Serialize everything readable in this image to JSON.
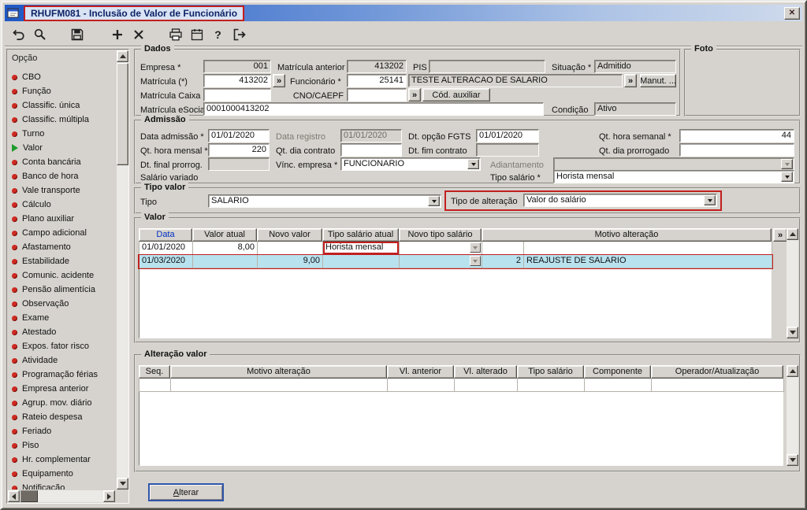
{
  "window": {
    "title": "RHUFM081 - Inclusão de Valor de Funcionário",
    "close_glyph": "✕"
  },
  "toolbar": {
    "icons": [
      "undo",
      "search",
      "save",
      "add",
      "delete",
      "print",
      "calendar",
      "help",
      "exit"
    ],
    "help_glyph": "?"
  },
  "sidebar": {
    "header": "Opção",
    "selected_item": "Valor",
    "items": [
      "CBO",
      "Função",
      "Classific. única",
      "Classific. múltipla",
      "Turno",
      "Valor",
      "Conta bancária",
      "Banco de hora",
      "Vale transporte",
      "Cálculo",
      "Plano auxiliar",
      "Campo adicional",
      "Afastamento",
      "Estabilidade",
      "Comunic. acidente",
      "Pensão alimentícia",
      "Observação",
      "Exame",
      "Atestado",
      "Expos. fator risco",
      "Atividade",
      "Programação férias",
      "Empresa anterior",
      "Agrup. mov. diário",
      "Rateio despesa",
      "Feriado",
      "Piso",
      "Hr. complementar",
      "Equipamento",
      "Notificação"
    ]
  },
  "dados": {
    "legend": "Dados",
    "empresa": {
      "label": "Empresa *",
      "value": "001"
    },
    "matricula_anterior": {
      "label": "Matrícula anterior",
      "value": "413202"
    },
    "pis": {
      "label": "PIS",
      "value": ""
    },
    "situacao": {
      "label": "Situação *",
      "value": "Admitido"
    },
    "matricula": {
      "label": "Matrícula (*)",
      "value": "413202"
    },
    "funcionario": {
      "label": "Funcionário *",
      "code": "25141",
      "name": "TESTE ALTERACAO DE SALARIO"
    },
    "manut_button": "Manut. ...",
    "matricula_caixa": {
      "label": "Matrícula Caixa",
      "value": ""
    },
    "cno_caepf": {
      "label": "CNO/CAEPF",
      "value": ""
    },
    "cod_auxiliar_button": "Cód. auxiliar",
    "matricula_esocial": {
      "label": "Matrícula eSocial",
      "value": "0001000413202"
    },
    "condicao": {
      "label": "Condição",
      "value": "Ativo"
    },
    "lookup_glyph": "»"
  },
  "foto": {
    "legend": "Foto"
  },
  "admissao": {
    "legend": "Admissão",
    "data_admissao": {
      "label": "Data admissão *",
      "value": "01/01/2020"
    },
    "data_registro": {
      "label": "Data registro",
      "value": "01/01/2020"
    },
    "dt_opcao_fgts": {
      "label": "Dt. opção FGTS",
      "value": "01/01/2020"
    },
    "qt_hora_semanal": {
      "label": "Qt. hora semanal *",
      "value": "44"
    },
    "qt_hora_mensal": {
      "label": "Qt. hora mensal *",
      "value": "220"
    },
    "qt_dia_contrato": {
      "label": "Qt. dia contrato",
      "value": ""
    },
    "dt_fim_contrato": {
      "label": "Dt. fim contrato",
      "value": ""
    },
    "qt_dia_prorrogado": {
      "label": "Qt. dia prorrogado",
      "value": ""
    },
    "dt_final_prorrog": {
      "label": "Dt. final prorrog.",
      "value": ""
    },
    "vinc_empresa": {
      "label": "Vínc. empresa *",
      "value": "FUNCIONARIO"
    },
    "adiantamento": {
      "label": "Adiantamento",
      "value": ""
    },
    "salario_variado": {
      "label": "Salário variado"
    },
    "tipo_salario": {
      "label": "Tipo salário *",
      "value": "Horista mensal"
    }
  },
  "tipo_valor": {
    "legend": "Tipo valor",
    "tipo": {
      "label": "Tipo",
      "value": "SALARIO"
    },
    "tipo_alteracao": {
      "label": "Tipo de alteração",
      "value": "Valor do salário"
    }
  },
  "valor": {
    "legend": "Valor",
    "columns": [
      "Data",
      "Valor atual",
      "Novo valor",
      "Tipo salário atual",
      "Novo tipo salário",
      "Motivo alteração"
    ],
    "lookup_glyph": "»",
    "rows": [
      {
        "data": "01/01/2020",
        "valor_atual": "8,00",
        "novo_valor": "",
        "tipo_salario_atual": "Horista mensal",
        "novo_tipo_salario": "",
        "motivo_codigo": "",
        "motivo_descricao": ""
      },
      {
        "data": "01/03/2020",
        "valor_atual": "",
        "novo_valor": "9,00",
        "tipo_salario_atual": "",
        "novo_tipo_salario": "",
        "motivo_codigo": "2",
        "motivo_descricao": "REAJUSTE DE SALARIO"
      }
    ]
  },
  "alteracao_valor": {
    "legend": "Alteração valor",
    "columns": [
      "Seq.",
      "Motivo alteração",
      "Vl. anterior",
      "Vl. alterado",
      "Tipo salário",
      "Componente",
      "Operador/Atualização"
    ]
  },
  "footer": {
    "alterar_accel": "A",
    "alterar_rest": "lterar"
  }
}
